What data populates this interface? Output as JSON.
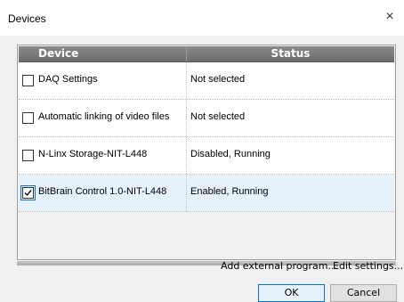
{
  "window": {
    "title": "Devices",
    "close_glyph": "×"
  },
  "table": {
    "columns": {
      "device": "Device",
      "status": "Status"
    },
    "rows": [
      {
        "device": "DAQ Settings",
        "status": "Not selected",
        "checked": false
      },
      {
        "device": "Automatic linking of video files",
        "status": "Not selected",
        "checked": false
      },
      {
        "device": "N-Linx Storage-NIT-L448",
        "status": "Disabled, Running",
        "checked": false
      },
      {
        "device": "BitBrain Control 1.0-NIT-L448",
        "status": "Enabled, Running",
        "checked": true
      }
    ]
  },
  "actions": {
    "add_external": "Add external program...",
    "edit_settings": "Edit settings..."
  },
  "buttons": {
    "ok": "OK",
    "cancel": "Cancel"
  },
  "colors": {
    "header": "#7a7a7a",
    "selected_row": "#e5f1fb",
    "focus": "#0078d7"
  }
}
